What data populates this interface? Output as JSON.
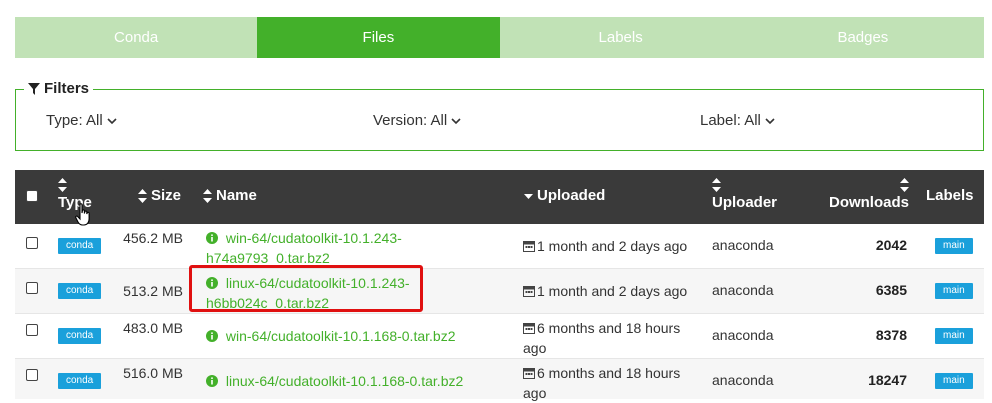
{
  "tabs": [
    {
      "label": "Conda",
      "active": false
    },
    {
      "label": "Files",
      "active": true
    },
    {
      "label": "Labels",
      "active": false
    },
    {
      "label": "Badges",
      "active": false
    }
  ],
  "filters": {
    "title": "Filters",
    "type": "Type: All",
    "version": "Version: All",
    "label": "Label: All"
  },
  "table": {
    "headers": {
      "type": "Type",
      "size": "Size",
      "name": "Name",
      "uploaded": "Uploaded",
      "uploader": "Uploader",
      "downloads": "Downloads",
      "labels": "Labels"
    },
    "rows": [
      {
        "type": "conda",
        "size": "456.2 MB",
        "name": "win-64/cudatoolkit-10.1.243-h74a9793_0.tar.bz2",
        "uploaded": "1 month and 2 days ago",
        "uploader": "anaconda",
        "downloads": "2042",
        "label": "main"
      },
      {
        "type": "conda",
        "size": "513.2 MB",
        "name": "linux-64/cudatoolkit-10.1.243-h6bb024c_0.tar.bz2",
        "uploaded": "1 month and 2 days ago",
        "uploader": "anaconda",
        "downloads": "6385",
        "label": "main"
      },
      {
        "type": "conda",
        "size": "483.0 MB",
        "name": "win-64/cudatoolkit-10.1.168-0.tar.bz2",
        "uploaded": "6 months and 18 hours ago",
        "uploader": "anaconda",
        "downloads": "8378",
        "label": "main"
      },
      {
        "type": "conda",
        "size": "516.0 MB",
        "name": "linux-64/cudatoolkit-10.1.168-0.tar.bz2",
        "uploaded": "6 months and 18 hours ago",
        "uploader": "anaconda",
        "downloads": "18247",
        "label": "main"
      }
    ]
  },
  "colors": {
    "accent": "#43b02a",
    "tab_inactive": "#c1e2b6",
    "header_bg": "#3a3a3a",
    "badge": "#1aa0db",
    "highlight": "#e01010"
  }
}
